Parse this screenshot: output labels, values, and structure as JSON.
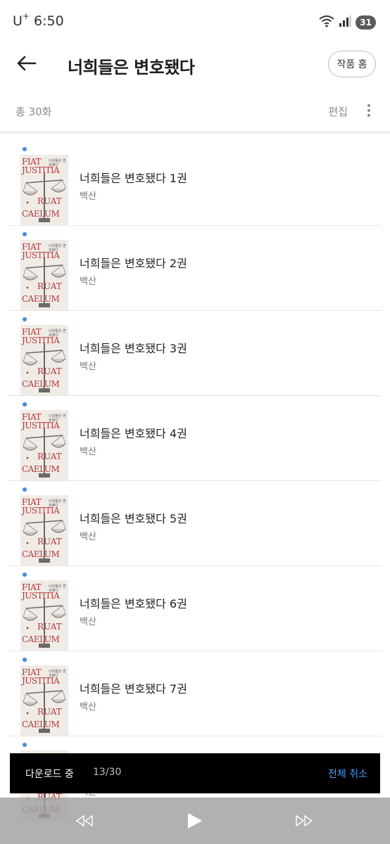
{
  "status_bar": {
    "carrier": "U",
    "carrier_sup": "+",
    "time": "6:50",
    "battery": "31",
    "icons": [
      "wifi-icon",
      "signal-icon",
      "battery-icon"
    ]
  },
  "header": {
    "title": "너희들은 변호됐다",
    "home_button": "작품 홈",
    "back_icon": "back-arrow-icon"
  },
  "toolbar": {
    "total_count": "총 30화",
    "edit_label": "편집",
    "more_icon": "more-vertical-icon"
  },
  "episodes": [
    {
      "title": "너희들은 변호됐다 1권",
      "author": "백산"
    },
    {
      "title": "너희들은 변호됐다 2권",
      "author": "백산"
    },
    {
      "title": "너희들은 변호됐다 3권",
      "author": "백산"
    },
    {
      "title": "너희들은 변호됐다 4권",
      "author": "백산"
    },
    {
      "title": "너희들은 변호됐다 5권",
      "author": "백산"
    },
    {
      "title": "너희들은 변호됐다 6권",
      "author": "백산"
    },
    {
      "title": "너희들은 변호됐다 7권",
      "author": "백산"
    },
    {
      "title": "",
      "author": "백산"
    }
  ],
  "cover": {
    "line1": "FIAT",
    "line2": "JUSTITIA",
    "line3": "RUAT",
    "line4": "CAELUM",
    "subtitle": "너희들은 변호됐다"
  },
  "download": {
    "label": "다운로드 중",
    "progress": "13/30",
    "cancel_label": "전체 취소"
  },
  "player": {
    "icons": [
      "rewind-icon",
      "play-icon",
      "fast-forward-icon"
    ]
  },
  "colors": {
    "accent": "#3a8ee6",
    "cancel": "#4a9cf2",
    "cover_text": "#b23a3a"
  }
}
